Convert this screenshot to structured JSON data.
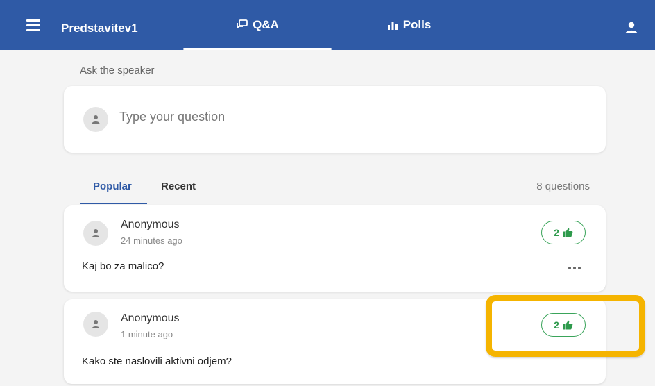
{
  "header": {
    "app_title": "Predstavitev1",
    "tabs": [
      {
        "label": "Q&A",
        "icon": "chat-bubbles-icon",
        "active": true
      },
      {
        "label": "Polls",
        "icon": "bar-chart-icon",
        "active": false
      }
    ]
  },
  "ask": {
    "label": "Ask the speaker",
    "placeholder": "Type your question"
  },
  "sort": {
    "tabs": [
      {
        "label": "Popular",
        "active": true
      },
      {
        "label": "Recent",
        "active": false
      }
    ],
    "count_text": "8 questions"
  },
  "questions": [
    {
      "author": "Anonymous",
      "time": "24 minutes ago",
      "text": "Kaj bo za malico?",
      "likes": "2"
    },
    {
      "author": "Anonymous",
      "time": "1 minute ago",
      "text": "Kako ste naslovili aktivni odjem?",
      "likes": "2"
    }
  ],
  "colors": {
    "header_bg": "#2f5aa6",
    "active_accent": "#2f5aa6",
    "like_green": "#3aa45a",
    "highlight": "#f5b400"
  }
}
